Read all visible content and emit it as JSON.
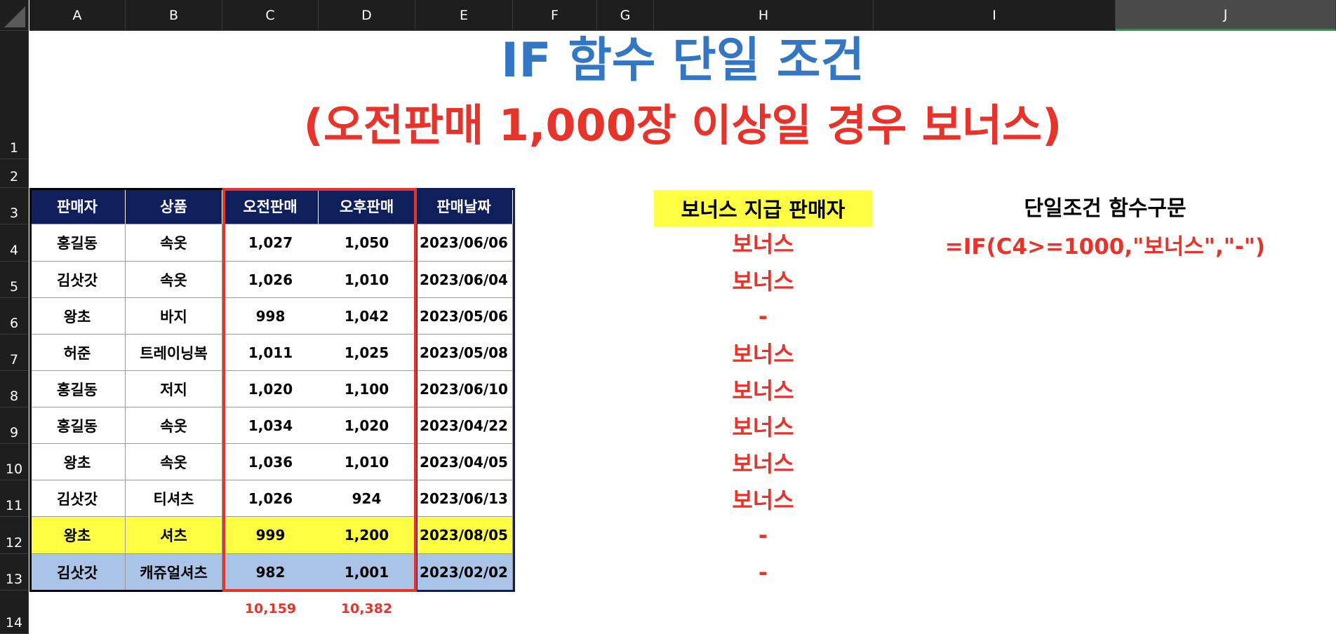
{
  "columns": [
    "A",
    "B",
    "C",
    "D",
    "E",
    "F",
    "G",
    "H",
    "I",
    "J"
  ],
  "rows": [
    "1",
    "2",
    "3",
    "4",
    "5",
    "6",
    "7",
    "8",
    "9",
    "10",
    "11",
    "12",
    "13",
    "14"
  ],
  "title": {
    "line1": "IF 함수 단일 조건",
    "line2": "(오전판매 1,000장 이상일 경우 보너스)"
  },
  "table": {
    "headers": [
      "판매자",
      "상품",
      "오전판매",
      "오후판매",
      "판매날짜"
    ],
    "rows": [
      [
        "홍길동",
        "속옷",
        "1,027",
        "1,050",
        "2023/06/06"
      ],
      [
        "김삿갓",
        "속옷",
        "1,026",
        "1,010",
        "2023/06/04"
      ],
      [
        "왕초",
        "바지",
        "998",
        "1,042",
        "2023/05/06"
      ],
      [
        "허준",
        "트레이닝복",
        "1,011",
        "1,025",
        "2023/05/08"
      ],
      [
        "홍길동",
        "저지",
        "1,020",
        "1,100",
        "2023/06/10"
      ],
      [
        "홍길동",
        "속옷",
        "1,034",
        "1,020",
        "2023/04/22"
      ],
      [
        "왕초",
        "속옷",
        "1,036",
        "1,010",
        "2023/04/05"
      ],
      [
        "김삿갓",
        "티셔츠",
        "1,026",
        "924",
        "2023/06/13"
      ],
      [
        "왕초",
        "셔츠",
        "999",
        "1,200",
        "2023/08/05"
      ],
      [
        "김삿갓",
        "캐쥬얼셔츠",
        "982",
        "1,001",
        "2023/02/02"
      ]
    ],
    "totals": [
      "10,159",
      "10,382"
    ]
  },
  "bonus": {
    "header": "보너스 지급 판매자",
    "values": [
      "보너스",
      "보너스",
      "-",
      "보너스",
      "보너스",
      "보너스",
      "보너스",
      "보너스",
      "-",
      "-"
    ]
  },
  "syntax": {
    "header": "단일조건 함수구문",
    "formula": "=IF(C4>=1000,\"보너스\",\"-\")"
  },
  "colors": {
    "header_bg": "#0f1f5c",
    "highlight_yellow": "#ffff44",
    "highlight_blue": "#a9c4e6",
    "accent_red": "#e8332a",
    "title_blue": "#3276c4"
  }
}
